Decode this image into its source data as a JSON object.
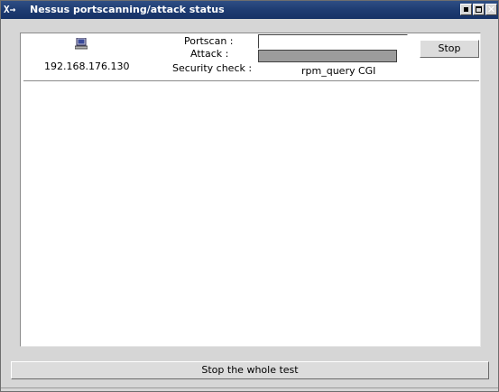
{
  "window": {
    "title": "Nessus portscanning/attack status",
    "app_icon_glyph": "X→",
    "controls": {
      "minimize": "minimize-icon",
      "maximize": "maximize-icon",
      "close_glyph": "✕"
    }
  },
  "scan": {
    "host_icon": "computer-icon",
    "host_ip": "192.168.176.130",
    "portscan_label": "Portscan :",
    "attack_label": "Attack :",
    "security_check_label": "Security check :",
    "portscan_progress": 0,
    "attack_progress": 1.0,
    "security_check_value": "rpm_query CGI",
    "stop_label": "Stop"
  },
  "footer": {
    "stop_whole_test_label": "Stop the whole test"
  },
  "colors": {
    "titlebar": "#1e3c72",
    "progress_fill": "#9c9c9c",
    "panel_bg": "#ffffff",
    "window_bg": "#d6d6d6"
  }
}
